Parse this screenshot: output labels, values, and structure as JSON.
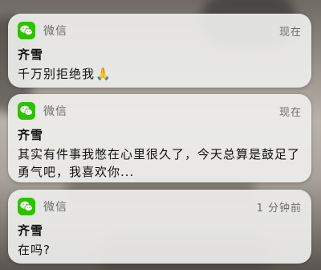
{
  "notifications": [
    {
      "app_name": "微信",
      "time": "现在",
      "sender": "齐雪",
      "message": "千万别拒绝我",
      "emoji": "🙏"
    },
    {
      "app_name": "微信",
      "time": "现在",
      "sender": "齐雪",
      "message": "其实有件事我憋在心里很久了，今天总算是鼓足了勇气吧，我喜欢你..."
    },
    {
      "app_name": "微信",
      "time": "1 分钟前",
      "sender": "齐雪",
      "message": "在吗?"
    }
  ],
  "icons": {
    "app": "wechat-icon",
    "emoji": "praying-hands-icon"
  },
  "colors": {
    "wechat_green": "#2dc100",
    "card_bg": "#eeeeec",
    "secondary_text": "#6d6d6d",
    "primary_text": "#111111"
  }
}
